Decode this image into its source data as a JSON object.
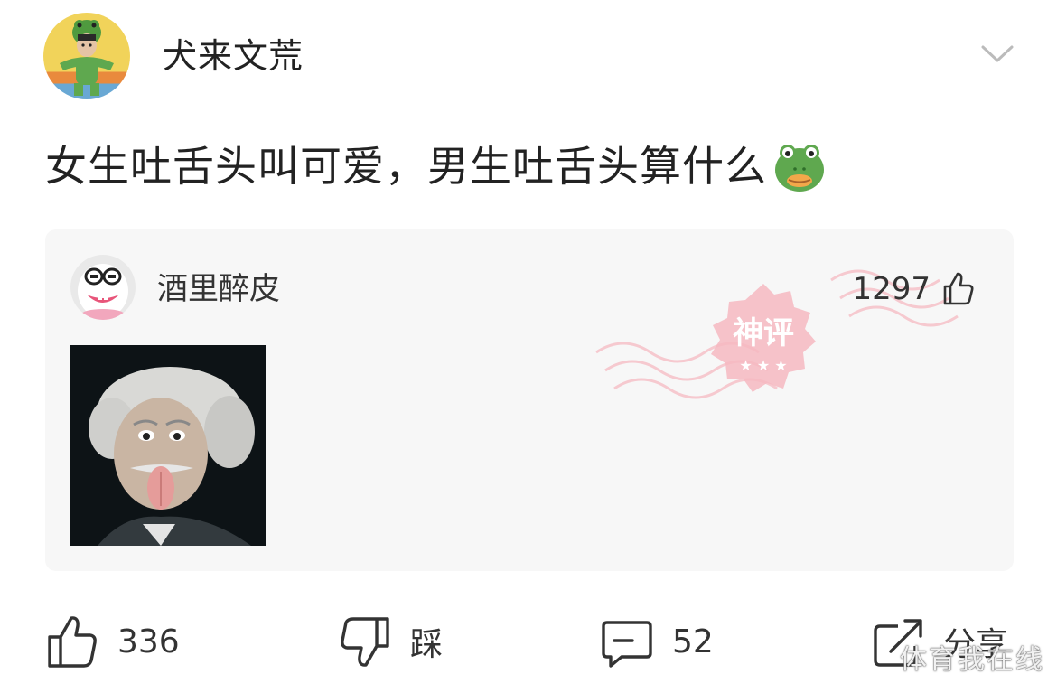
{
  "post": {
    "author_name": "犬来文荒",
    "text": "女生吐舌头叫可爱，男生吐舌头算什么",
    "text_emoji": "frog-face-emoji"
  },
  "comment": {
    "author_name": "酒里醉皮",
    "like_count": "1297",
    "badge": "神评",
    "image": "einstein-tongue-photo"
  },
  "actions": {
    "like_label": "336",
    "dislike_label": "踩",
    "comment_label": "52",
    "share_label": "分享"
  },
  "watermark": "体育我在线",
  "colors": {
    "text": "#222222",
    "card_bg": "#f7f7f7",
    "stamp": "#f4a9b3",
    "frog_green": "#5fa84f"
  }
}
